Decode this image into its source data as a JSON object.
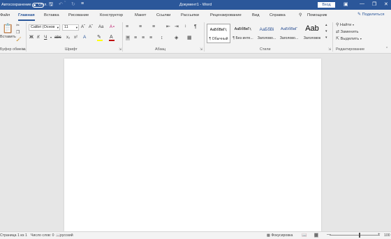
{
  "titlebar": {
    "autosave_label": "Автосохранение",
    "autosave_state": "Откл.",
    "doc_title": "Документ1 - Word",
    "signin_label": "Вход"
  },
  "tabs": [
    {
      "label": "Файл"
    },
    {
      "label": "Главная"
    },
    {
      "label": "Вставка"
    },
    {
      "label": "Рисование"
    },
    {
      "label": "Конструктор"
    },
    {
      "label": "Макет"
    },
    {
      "label": "Ссылки"
    },
    {
      "label": "Рассылки"
    },
    {
      "label": "Рецензирование"
    },
    {
      "label": "Вид"
    },
    {
      "label": "Справка"
    },
    {
      "label": "Помощник"
    }
  ],
  "share_label": "Поделиться",
  "ribbon": {
    "clipboard": {
      "paste_label": "Вставить",
      "group_label": "Буфер обмена"
    },
    "font": {
      "font_name": "Calibri (Основ",
      "font_size": "11",
      "group_label": "Шрифт"
    },
    "paragraph": {
      "group_label": "Абзац"
    },
    "styles": {
      "group_label": "Стили",
      "items": [
        {
          "sample": "АаБбВвГг,",
          "name": "¶ Обычный"
        },
        {
          "sample": "АаБбВвГг,",
          "name": "¶ Без инте..."
        },
        {
          "sample": "АаБбВі",
          "name": "Заголово..."
        },
        {
          "sample": "АаБбВвГ",
          "name": "Заголово..."
        },
        {
          "sample": "Aab",
          "name": "Заголовок"
        }
      ]
    },
    "editing": {
      "find_label": "Найти",
      "replace_label": "Заменить",
      "select_label": "Выделить",
      "group_label": "Редактирование"
    }
  },
  "statusbar": {
    "page": "Страница 1 из 1",
    "words": "Число слов: 0",
    "language": "русский",
    "focus": "Фокусировка",
    "zoom": "100"
  },
  "colors": {
    "brand": "#2b579a",
    "highlight": "#ffff00",
    "font_color": "#c00000"
  }
}
